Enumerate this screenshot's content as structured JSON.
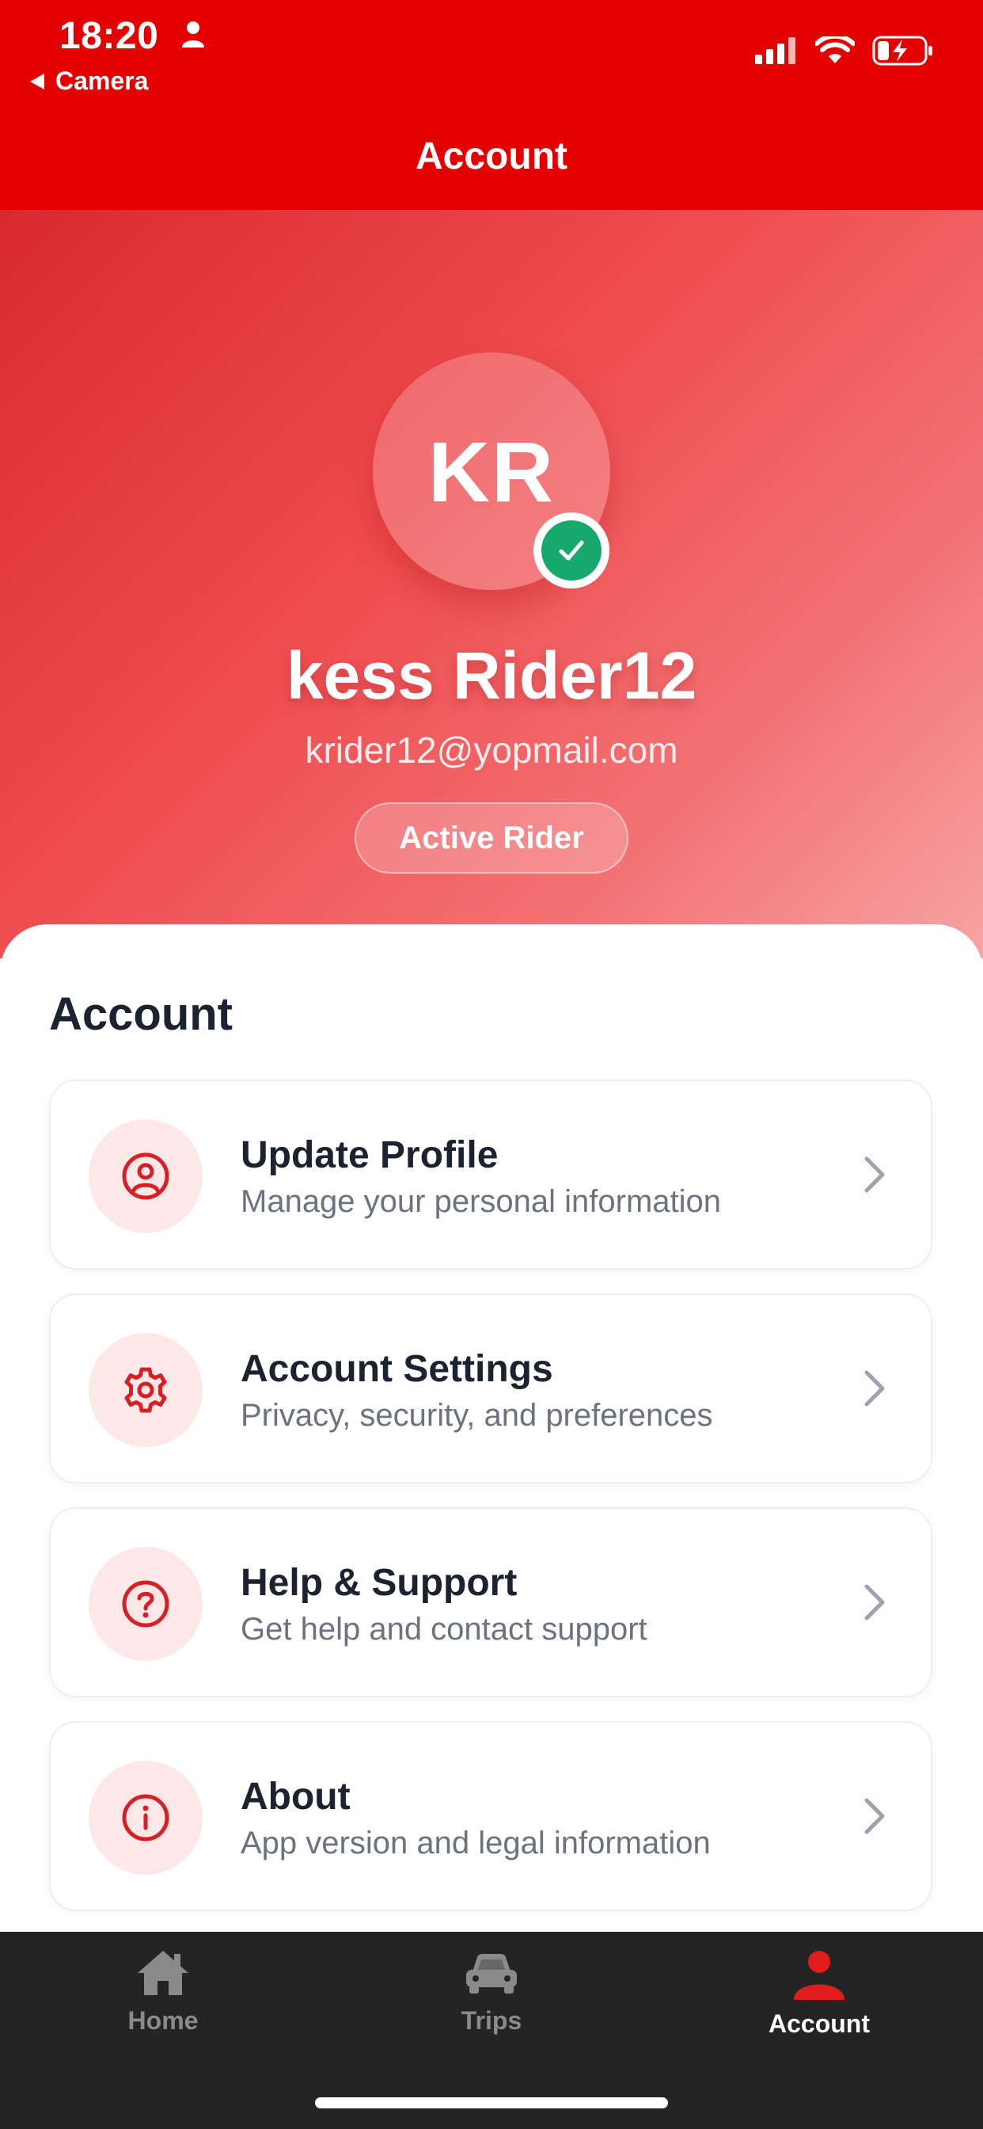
{
  "status_bar": {
    "time": "18:20",
    "back_label": "Camera"
  },
  "nav": {
    "title": "Account"
  },
  "profile": {
    "initials": "KR",
    "name": "kess Rider12",
    "email": "krider12@yopmail.com",
    "role": "Active Rider"
  },
  "section": {
    "title": "Account"
  },
  "menu": [
    {
      "title": "Update Profile",
      "subtitle": "Manage your personal information",
      "icon": "user-circle-icon"
    },
    {
      "title": "Account Settings",
      "subtitle": "Privacy, security, and preferences",
      "icon": "gear-icon"
    },
    {
      "title": "Help & Support",
      "subtitle": "Get help and contact support",
      "icon": "question-circle-icon"
    },
    {
      "title": "About",
      "subtitle": "App version and legal information",
      "icon": "info-circle-icon"
    }
  ],
  "tabbar": {
    "home": "Home",
    "trips": "Trips",
    "account": "Account",
    "active": "Account"
  },
  "colors": {
    "brand": "#e50000",
    "accent_icon": "#d81f26",
    "icon_bg": "#fde8e8",
    "verified": "#17a86b",
    "tabbar_bg": "#242424",
    "tab_inactive": "#8a8a8a"
  }
}
